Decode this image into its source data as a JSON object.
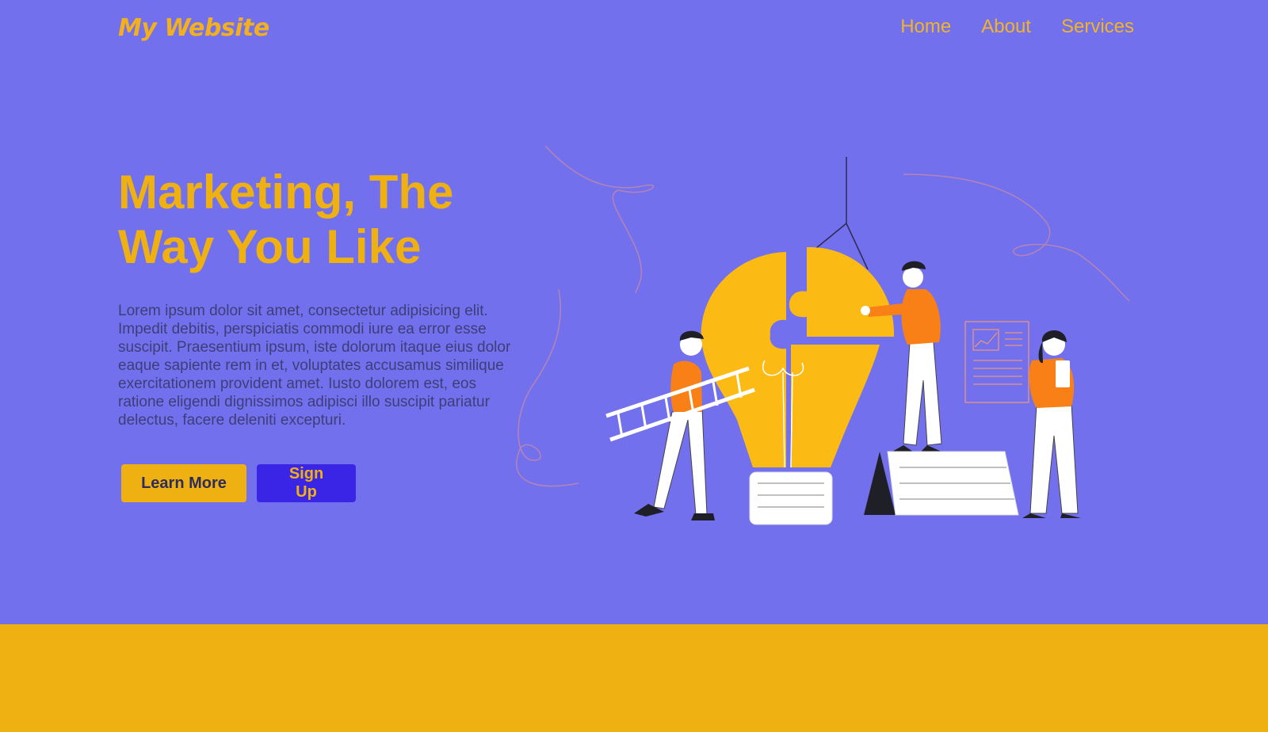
{
  "brand": {
    "logo_text": "My Website"
  },
  "nav": {
    "items": [
      "Home",
      "About",
      "Services"
    ]
  },
  "hero": {
    "headline": "Marketing, The Way You Like",
    "body": "Lorem ipsum dolor sit amet, consectetur adipisicing elit. Impedit debitis, perspiciatis commodi iure ea error esse suscipit. Praesentium ipsum, iste dolorum itaque eius dolor eaque sapiente rem in et, voluptates accusamus similique exercitationem provident amet. Iusto dolorem est, eos ratione eligendi dignissimos adipisci illo suscipit pariatur delectus, facere deleniti excepturi.",
    "primary_button": "Learn More",
    "secondary_button": "Sign Up"
  },
  "colors": {
    "hero_background": "#7370ed",
    "accent_yellow": "#efb112",
    "button_blue": "#3a25e6",
    "body_text": "#3d3e78"
  }
}
